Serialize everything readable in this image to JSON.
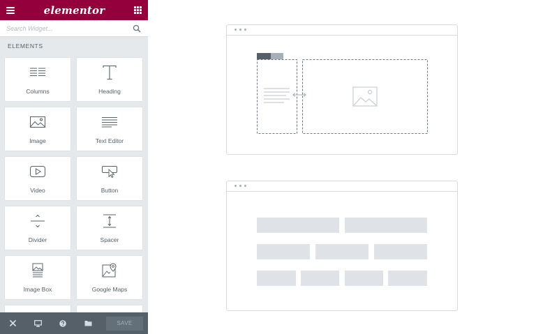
{
  "app": {
    "logo_text": "elementor",
    "brand_color": "#93003c"
  },
  "search": {
    "placeholder": "Search Widget..."
  },
  "section": {
    "title": "ELEMENTS"
  },
  "widgets": [
    {
      "label": "Columns",
      "icon": "columns-icon"
    },
    {
      "label": "Heading",
      "icon": "heading-icon"
    },
    {
      "label": "Image",
      "icon": "image-icon"
    },
    {
      "label": "Text Editor",
      "icon": "text-editor-icon"
    },
    {
      "label": "Video",
      "icon": "video-icon"
    },
    {
      "label": "Button",
      "icon": "button-icon"
    },
    {
      "label": "Divider",
      "icon": "divider-icon"
    },
    {
      "label": "Spacer",
      "icon": "spacer-icon"
    },
    {
      "label": "Image Box",
      "icon": "image-box-icon"
    },
    {
      "label": "Google Maps",
      "icon": "google-maps-icon"
    }
  ],
  "footer": {
    "save_label": "SAVE",
    "icons": [
      "close-icon",
      "responsive-icon",
      "help-icon",
      "templates-folder-icon"
    ]
  }
}
